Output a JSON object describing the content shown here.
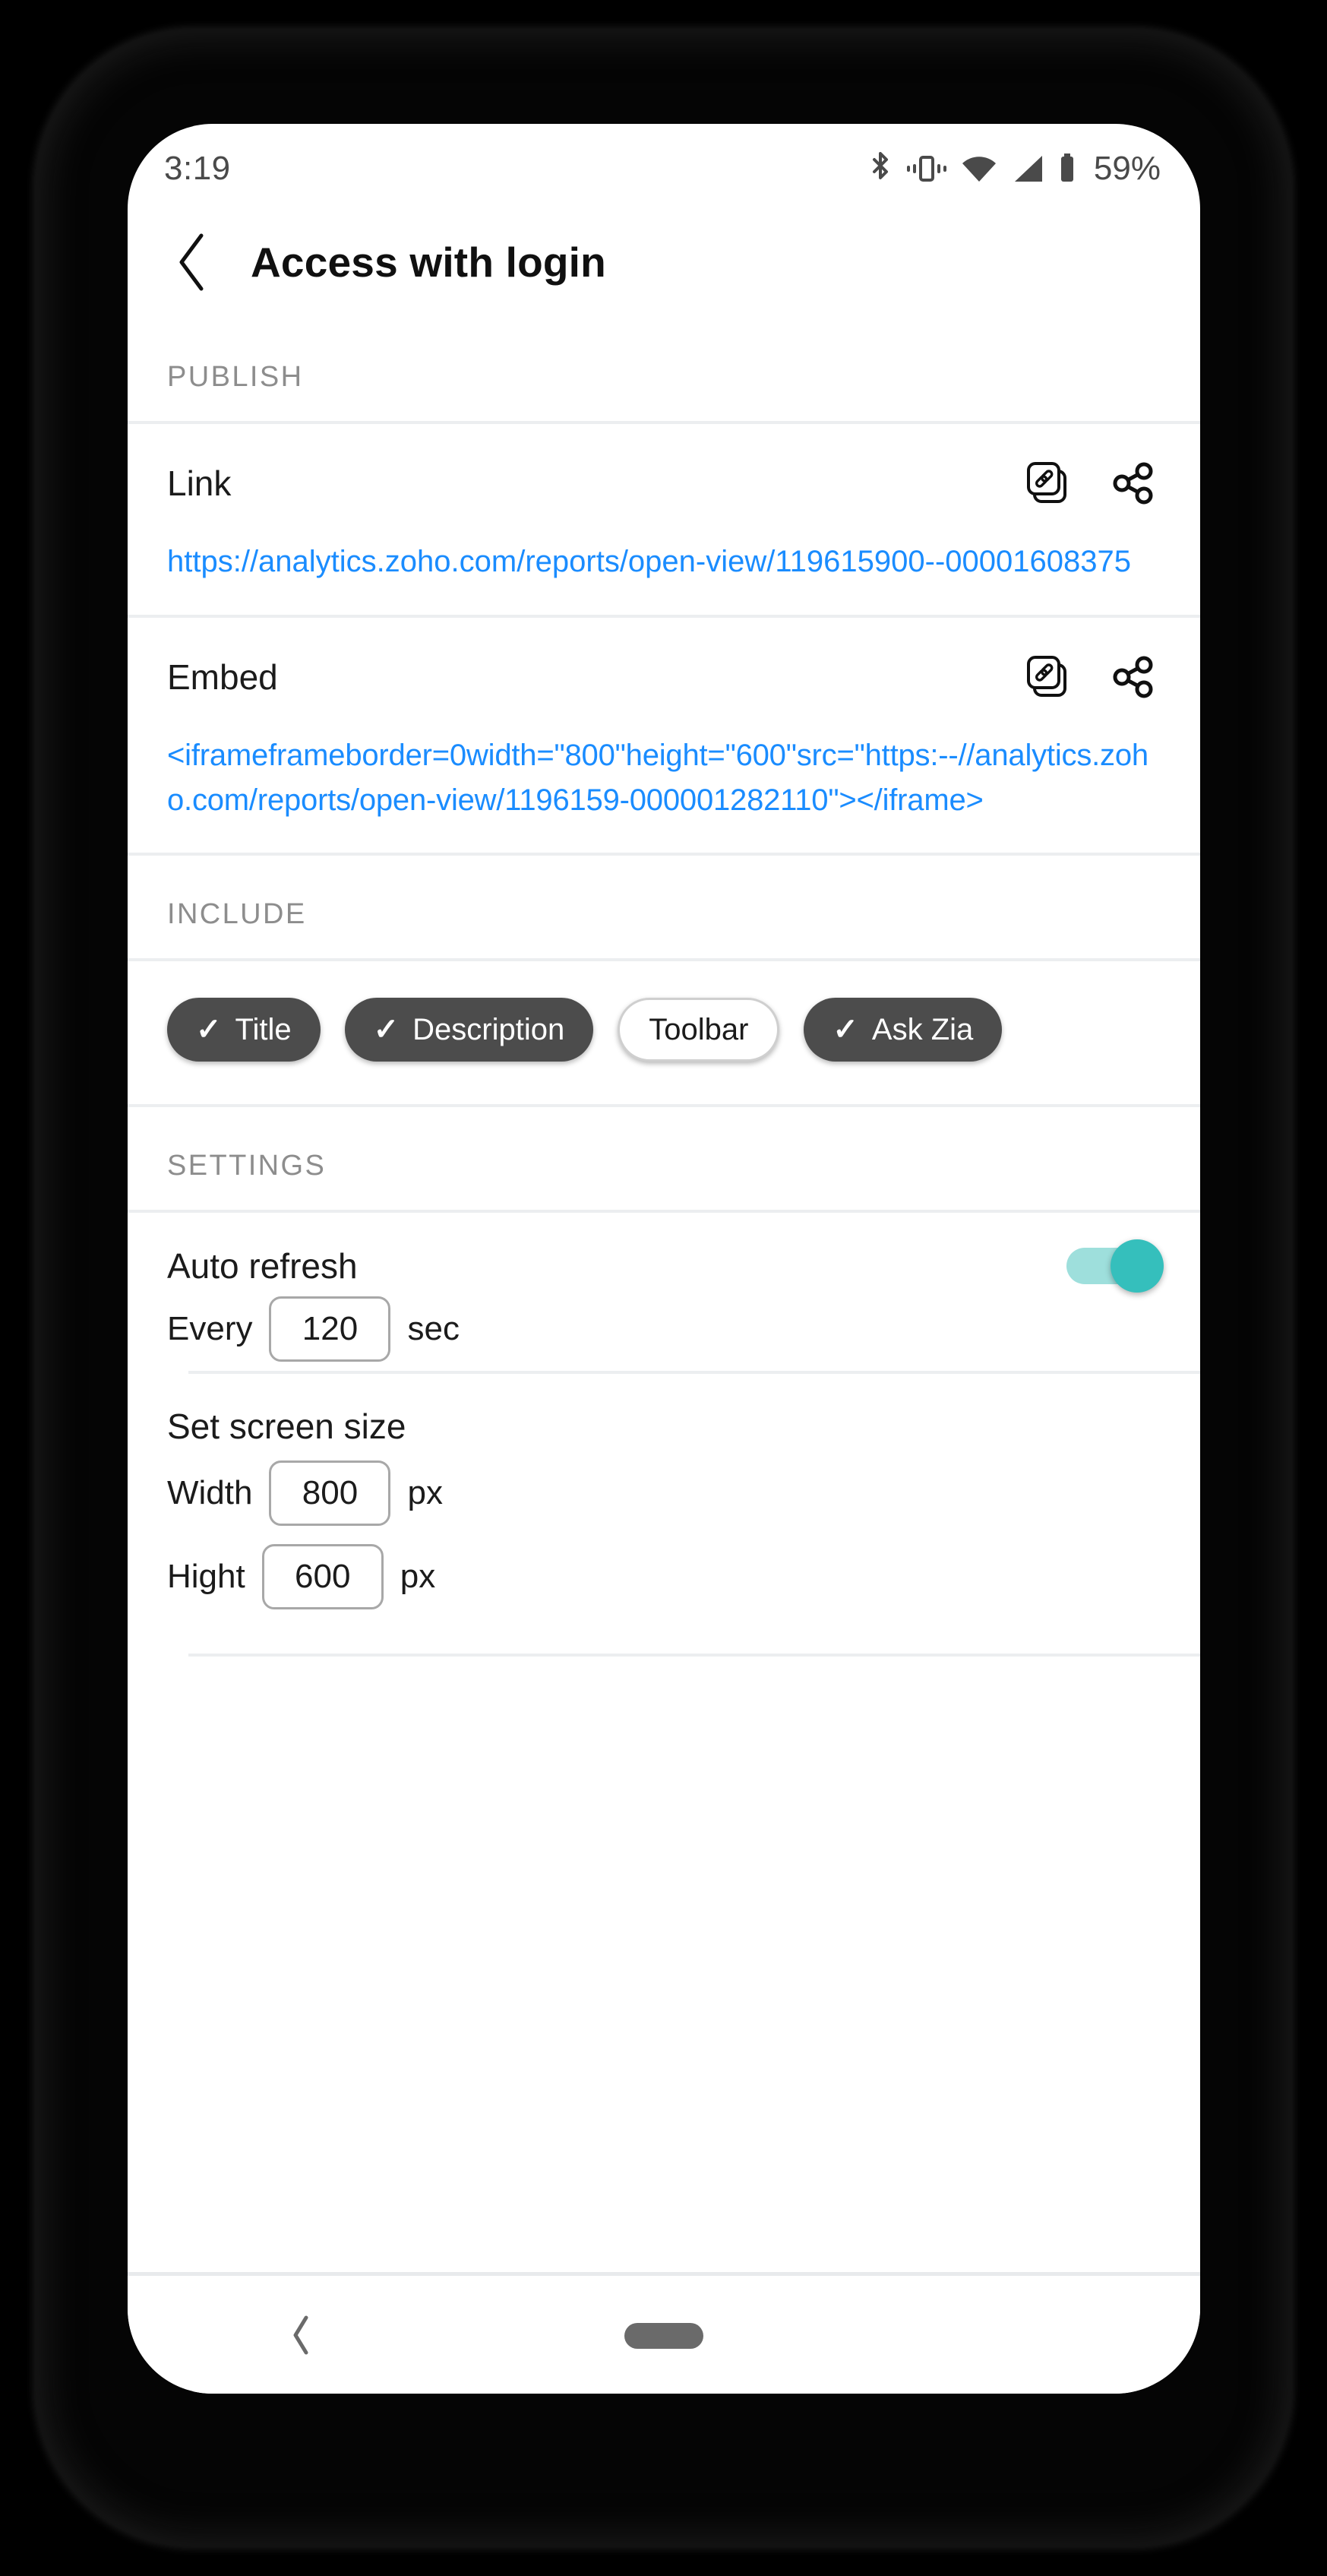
{
  "status_bar": {
    "time": "3:19",
    "battery_percent": "59%",
    "icons": [
      "bluetooth-icon",
      "vibrate-icon",
      "wifi-icon",
      "signal-icon",
      "battery-icon"
    ]
  },
  "app_bar": {
    "back_icon": "chevron-left-icon",
    "title": "Access with login"
  },
  "publish": {
    "header": "PUBLISH",
    "rows": [
      {
        "label": "Link",
        "value": "https://analytics.zoho.com/reports/open-view/119615900--00001608375",
        "copy_icon": "copy-link-icon",
        "share_icon": "share-icon"
      },
      {
        "label": "Embed",
        "value": "<iframeframeborder=0width=\"800\"height=\"600\"src=\"https:--//analytics.zoho.com/reports/open-view/1196159-000001282110\"></iframe>",
        "copy_icon": "copy-link-icon",
        "share_icon": "share-icon"
      }
    ]
  },
  "include": {
    "header": "INCLUDE",
    "chips": [
      {
        "label": "Title",
        "selected": true,
        "tick": "✓"
      },
      {
        "label": "Description",
        "selected": true,
        "tick": "✓"
      },
      {
        "label": "Toolbar",
        "selected": false,
        "tick": ""
      },
      {
        "label": "Ask Zia",
        "selected": true,
        "tick": "✓"
      }
    ]
  },
  "settings": {
    "header": "SETTINGS",
    "auto_refresh": {
      "label": "Auto refresh",
      "enabled": true,
      "interval_prefix": "Every",
      "interval_value": "120",
      "interval_unit": "sec"
    },
    "screen_size": {
      "title": "Set screen size",
      "width_label": "Width",
      "width_value": "800",
      "width_unit": "px",
      "height_label": "Hight",
      "height_value": "600",
      "height_unit": "px"
    }
  },
  "nav_bar": {
    "back_icon": "chevron-left-icon",
    "home_icon": "home-pill-icon"
  },
  "colors": {
    "link": "#1a8cff",
    "toggle_thumb": "#35bfbc",
    "toggle_track": "#9edfdc",
    "chip_selected": "#4c4c4c",
    "section_header": "#8d8d8d"
  }
}
